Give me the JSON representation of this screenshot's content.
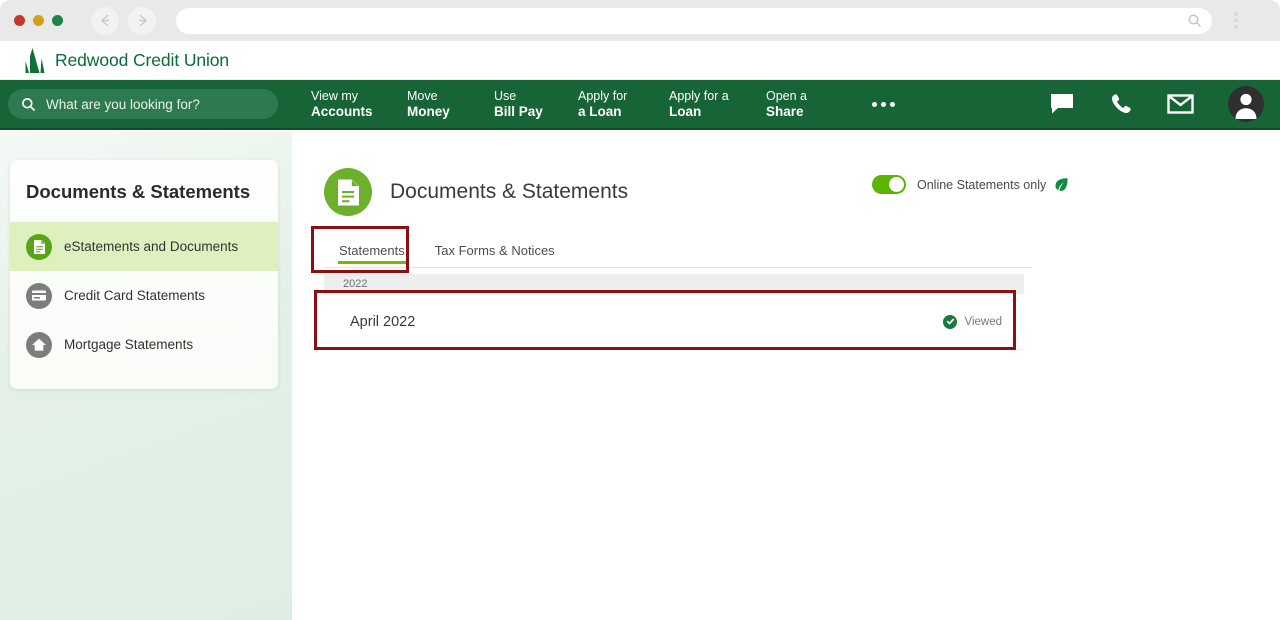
{
  "browser": {
    "back_icon": "arrow-left-icon",
    "forward_icon": "arrow-right-icon",
    "address_value": "",
    "address_search_icon": "search-icon",
    "menu_icon": "kebab-menu-icon"
  },
  "brand": {
    "name": "Redwood Credit Union",
    "logo_icon": "redwood-trees-logo",
    "color": "#0b6b3a"
  },
  "nav": {
    "search": {
      "icon": "search-icon",
      "placeholder": "What are you looking for?"
    },
    "items": [
      {
        "line1": "View my",
        "line2": "Accounts"
      },
      {
        "line1": "Move",
        "line2": "Money"
      },
      {
        "line1": "Use",
        "line2": "Bill Pay"
      },
      {
        "line1": "Apply for",
        "line2": "a Loan"
      },
      {
        "line1": "Apply for a",
        "line2": "Loan"
      },
      {
        "line1": "Open a",
        "line2": "Share"
      }
    ],
    "more_icon": "ellipsis-icon",
    "icons": [
      {
        "name": "chat-bubble-icon"
      },
      {
        "name": "phone-icon"
      },
      {
        "name": "envelope-icon"
      },
      {
        "name": "user-avatar-icon"
      }
    ],
    "bar_color": "#176437"
  },
  "sidebar": {
    "title": "Documents & Statements",
    "items": [
      {
        "label": "eStatements and Documents",
        "icon": "document-icon",
        "active": true
      },
      {
        "label": "Credit Card Statements",
        "icon": "credit-card-icon",
        "active": false
      },
      {
        "label": "Mortgage Statements",
        "icon": "home-icon",
        "active": false
      }
    ],
    "active_bg": "#dff0bf"
  },
  "main": {
    "page_icon": "document-icon",
    "page_title": "Documents & Statements",
    "toggle": {
      "label": "Online Statements only",
      "state": "on",
      "color": "#5cb300",
      "leaf_icon": "leaf-icon"
    },
    "tabs": [
      {
        "label": "Statements",
        "active": true
      },
      {
        "label": "Tax Forms & Notices",
        "active": false
      }
    ],
    "active_tab_underline_color": "#7ab800",
    "year_group": "2022",
    "statements": [
      {
        "name": "April 2022",
        "status": "Viewed",
        "status_icon": "check-circle-icon"
      }
    ],
    "annotation_color": "#8c1010"
  }
}
